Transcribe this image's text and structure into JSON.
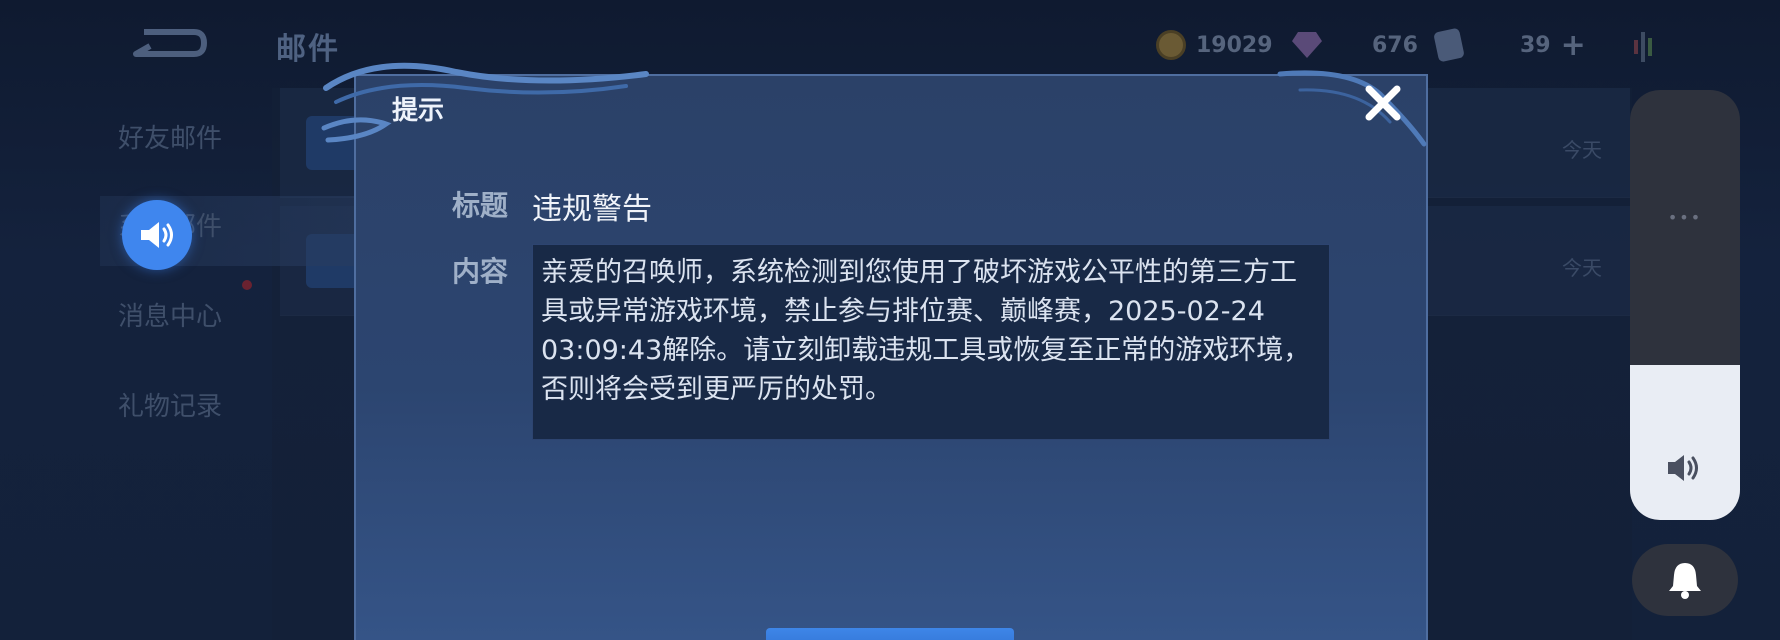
{
  "header": {
    "title": "邮件",
    "coins": "19029",
    "gems": "676",
    "tickets": "39"
  },
  "sidebar": {
    "items": [
      {
        "label": "好友邮件"
      },
      {
        "label": "系统邮件"
      },
      {
        "label": "消息中心"
      },
      {
        "label": "礼物记录"
      }
    ]
  },
  "mail_list": {
    "rows": [
      {
        "time": "今天"
      },
      {
        "time": "今天"
      }
    ]
  },
  "dialog": {
    "title": "提示",
    "subject_label": "标题",
    "subject_value": "违规警告",
    "content_label": "内容",
    "content_text": "亲爱的召唤师，系统检测到您使用了破坏游戏公平性的第三方工具或异常游戏环境，禁止参与排位赛、巅峰赛，2025-02-24\n03:09:43解除。请立刻卸载违规工具或恢复至正常的游戏环境，否则将会受到更严厉的处罚。"
  },
  "volume": {
    "level_fraction": 0.36,
    "menu_dots": "•••"
  },
  "icons": {
    "back": "back-arrow-icon",
    "coin": "gold-coin-icon",
    "gem": "diamond-icon",
    "ticket": "ticket-icon",
    "close": "close-x-icon",
    "speaker": "speaker-icon",
    "bell": "bell-icon"
  },
  "colors": {
    "accent_blue": "#3f86ee",
    "dialog_bg": "#2c4570",
    "content_bg": "#182946"
  }
}
